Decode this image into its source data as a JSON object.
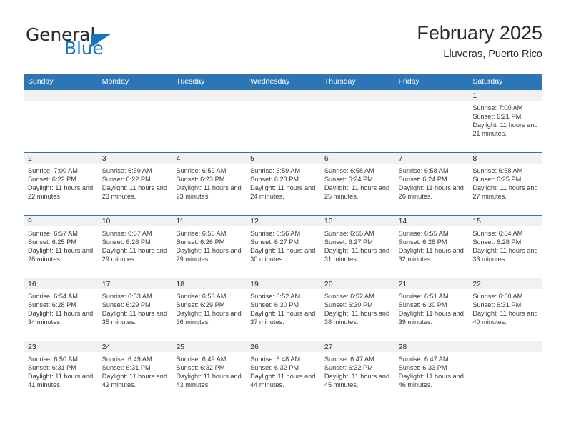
{
  "brand": {
    "name_primary": "General",
    "name_secondary": "Blue",
    "accent_color": "#1b75bc"
  },
  "header": {
    "month_title": "February 2025",
    "location": "Lluveras, Puerto Rico"
  },
  "calendar": {
    "header_color": "#2e75b6",
    "weekdays": [
      "Sunday",
      "Monday",
      "Tuesday",
      "Wednesday",
      "Thursday",
      "Friday",
      "Saturday"
    ],
    "weeks": [
      [
        {
          "day": "",
          "sunrise": "",
          "sunset": "",
          "daylight": ""
        },
        {
          "day": "",
          "sunrise": "",
          "sunset": "",
          "daylight": ""
        },
        {
          "day": "",
          "sunrise": "",
          "sunset": "",
          "daylight": ""
        },
        {
          "day": "",
          "sunrise": "",
          "sunset": "",
          "daylight": ""
        },
        {
          "day": "",
          "sunrise": "",
          "sunset": "",
          "daylight": ""
        },
        {
          "day": "",
          "sunrise": "",
          "sunset": "",
          "daylight": ""
        },
        {
          "day": "1",
          "sunrise": "Sunrise: 7:00 AM",
          "sunset": "Sunset: 6:21 PM",
          "daylight": "Daylight: 11 hours and 21 minutes."
        }
      ],
      [
        {
          "day": "2",
          "sunrise": "Sunrise: 7:00 AM",
          "sunset": "Sunset: 6:22 PM",
          "daylight": "Daylight: 11 hours and 22 minutes."
        },
        {
          "day": "3",
          "sunrise": "Sunrise: 6:59 AM",
          "sunset": "Sunset: 6:22 PM",
          "daylight": "Daylight: 11 hours and 23 minutes."
        },
        {
          "day": "4",
          "sunrise": "Sunrise: 6:59 AM",
          "sunset": "Sunset: 6:23 PM",
          "daylight": "Daylight: 11 hours and 23 minutes."
        },
        {
          "day": "5",
          "sunrise": "Sunrise: 6:59 AM",
          "sunset": "Sunset: 6:23 PM",
          "daylight": "Daylight: 11 hours and 24 minutes."
        },
        {
          "day": "6",
          "sunrise": "Sunrise: 6:58 AM",
          "sunset": "Sunset: 6:24 PM",
          "daylight": "Daylight: 11 hours and 25 minutes."
        },
        {
          "day": "7",
          "sunrise": "Sunrise: 6:58 AM",
          "sunset": "Sunset: 6:24 PM",
          "daylight": "Daylight: 11 hours and 26 minutes."
        },
        {
          "day": "8",
          "sunrise": "Sunrise: 6:58 AM",
          "sunset": "Sunset: 6:25 PM",
          "daylight": "Daylight: 11 hours and 27 minutes."
        }
      ],
      [
        {
          "day": "9",
          "sunrise": "Sunrise: 6:57 AM",
          "sunset": "Sunset: 6:25 PM",
          "daylight": "Daylight: 11 hours and 28 minutes."
        },
        {
          "day": "10",
          "sunrise": "Sunrise: 6:57 AM",
          "sunset": "Sunset: 6:26 PM",
          "daylight": "Daylight: 11 hours and 29 minutes."
        },
        {
          "day": "11",
          "sunrise": "Sunrise: 6:56 AM",
          "sunset": "Sunset: 6:26 PM",
          "daylight": "Daylight: 11 hours and 29 minutes."
        },
        {
          "day": "12",
          "sunrise": "Sunrise: 6:56 AM",
          "sunset": "Sunset: 6:27 PM",
          "daylight": "Daylight: 11 hours and 30 minutes."
        },
        {
          "day": "13",
          "sunrise": "Sunrise: 6:55 AM",
          "sunset": "Sunset: 6:27 PM",
          "daylight": "Daylight: 11 hours and 31 minutes."
        },
        {
          "day": "14",
          "sunrise": "Sunrise: 6:55 AM",
          "sunset": "Sunset: 6:28 PM",
          "daylight": "Daylight: 11 hours and 32 minutes."
        },
        {
          "day": "15",
          "sunrise": "Sunrise: 6:54 AM",
          "sunset": "Sunset: 6:28 PM",
          "daylight": "Daylight: 11 hours and 33 minutes."
        }
      ],
      [
        {
          "day": "16",
          "sunrise": "Sunrise: 6:54 AM",
          "sunset": "Sunset: 6:28 PM",
          "daylight": "Daylight: 11 hours and 34 minutes."
        },
        {
          "day": "17",
          "sunrise": "Sunrise: 6:53 AM",
          "sunset": "Sunset: 6:29 PM",
          "daylight": "Daylight: 11 hours and 35 minutes."
        },
        {
          "day": "18",
          "sunrise": "Sunrise: 6:53 AM",
          "sunset": "Sunset: 6:29 PM",
          "daylight": "Daylight: 11 hours and 36 minutes."
        },
        {
          "day": "19",
          "sunrise": "Sunrise: 6:52 AM",
          "sunset": "Sunset: 6:30 PM",
          "daylight": "Daylight: 11 hours and 37 minutes."
        },
        {
          "day": "20",
          "sunrise": "Sunrise: 6:52 AM",
          "sunset": "Sunset: 6:30 PM",
          "daylight": "Daylight: 11 hours and 38 minutes."
        },
        {
          "day": "21",
          "sunrise": "Sunrise: 6:51 AM",
          "sunset": "Sunset: 6:30 PM",
          "daylight": "Daylight: 11 hours and 39 minutes."
        },
        {
          "day": "22",
          "sunrise": "Sunrise: 6:50 AM",
          "sunset": "Sunset: 6:31 PM",
          "daylight": "Daylight: 11 hours and 40 minutes."
        }
      ],
      [
        {
          "day": "23",
          "sunrise": "Sunrise: 6:50 AM",
          "sunset": "Sunset: 6:31 PM",
          "daylight": "Daylight: 11 hours and 41 minutes."
        },
        {
          "day": "24",
          "sunrise": "Sunrise: 6:49 AM",
          "sunset": "Sunset: 6:31 PM",
          "daylight": "Daylight: 11 hours and 42 minutes."
        },
        {
          "day": "25",
          "sunrise": "Sunrise: 6:49 AM",
          "sunset": "Sunset: 6:32 PM",
          "daylight": "Daylight: 11 hours and 43 minutes."
        },
        {
          "day": "26",
          "sunrise": "Sunrise: 6:48 AM",
          "sunset": "Sunset: 6:32 PM",
          "daylight": "Daylight: 11 hours and 44 minutes."
        },
        {
          "day": "27",
          "sunrise": "Sunrise: 6:47 AM",
          "sunset": "Sunset: 6:32 PM",
          "daylight": "Daylight: 11 hours and 45 minutes."
        },
        {
          "day": "28",
          "sunrise": "Sunrise: 6:47 AM",
          "sunset": "Sunset: 6:33 PM",
          "daylight": "Daylight: 11 hours and 46 minutes."
        },
        {
          "day": "",
          "sunrise": "",
          "sunset": "",
          "daylight": ""
        }
      ]
    ]
  }
}
